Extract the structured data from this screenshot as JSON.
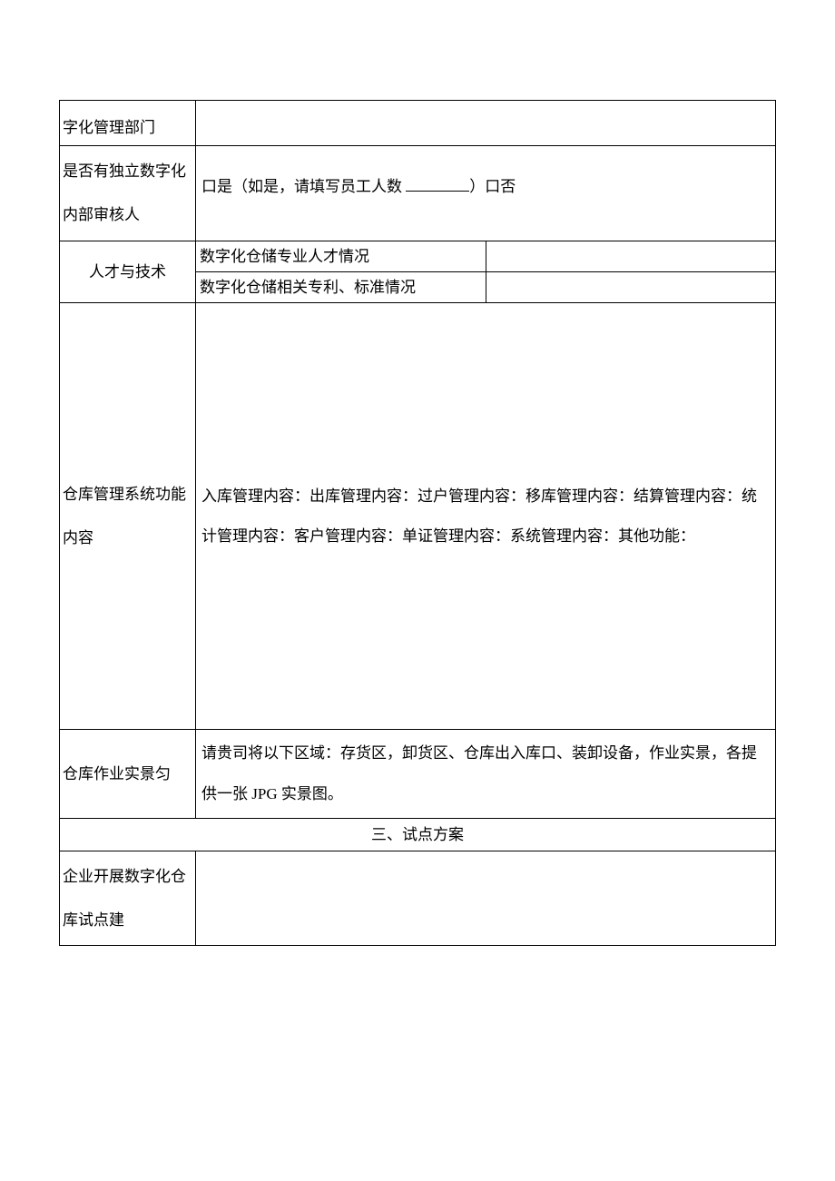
{
  "row1": {
    "label": "字化管理部门"
  },
  "row2": {
    "label": "是否有独立数字化内部审核人",
    "option_yes_prefix": "口是（如是，请填写员工人数 ",
    "option_yes_suffix": "）口否"
  },
  "row3": {
    "label": "人才与技术",
    "sub1": "数字化仓储专业人才情况",
    "sub2": "数字化仓储相关专利、标准情况"
  },
  "row4": {
    "label": "仓库管理系统功能内容",
    "content": "入库管理内容：出库管理内容：过户管理内容：移库管理内容：结算管理内容：统计管理内容：客户管理内容：单证管理内容：系统管理内容：其他功能："
  },
  "row5": {
    "label": "仓库作业实景匀",
    "content": "请贵司将以下区域：存货区，卸货区、仓库出入库口、装卸设备，作业实景，各提供一张 JPG 实景图。"
  },
  "section3": {
    "title": "三、试点方案"
  },
  "row6": {
    "label": "企业开展数字化仓库试点建"
  }
}
